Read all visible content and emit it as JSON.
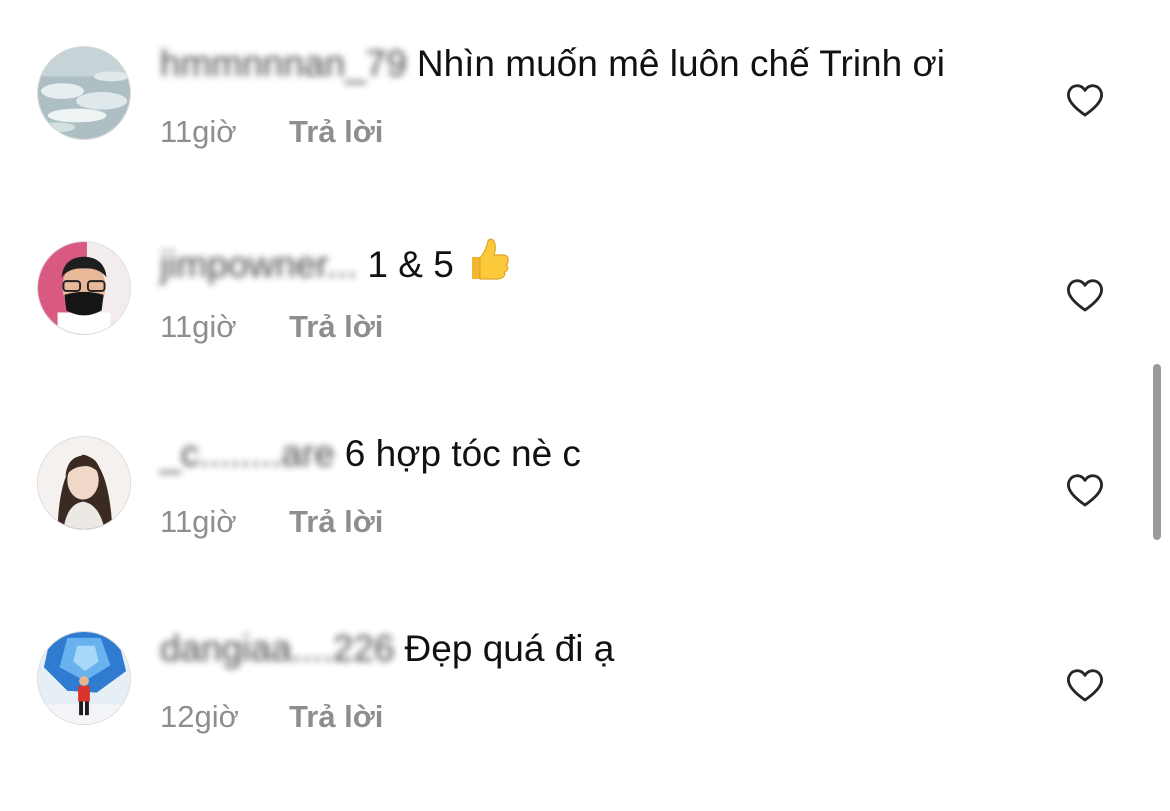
{
  "comments": [
    {
      "username": "hmmnnnan_79",
      "text": "Nhìn muốn mê luôn chế Trinh ơi",
      "time": "11giờ",
      "reply": "Trả lời",
      "avatar_icon": "sea-foam-avatar"
    },
    {
      "username": "jimpowner...",
      "text": "1 & 5",
      "emoji": "thumbs-up",
      "time": "11giờ",
      "reply": "Trả lời",
      "avatar_icon": "man-with-mask-avatar"
    },
    {
      "username": "_c........are",
      "text": "6 hợp tóc nè c",
      "time": "11giờ",
      "reply": "Trả lời",
      "avatar_icon": "woman-portrait-avatar"
    },
    {
      "username": "dangiaa....226",
      "text": "Đẹp quá đi ạ",
      "time": "12giờ",
      "reply": "Trả lời",
      "avatar_icon": "person-blue-backdrop-avatar"
    }
  ],
  "like_icon": "heart-outline-icon",
  "colors": {
    "text": "#111111",
    "meta": "#8e8e8e",
    "icon": "#262626",
    "scrollbar": "#9a9a9a"
  }
}
